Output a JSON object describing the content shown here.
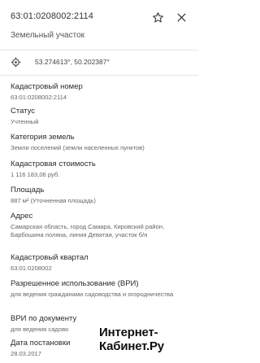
{
  "header": {
    "title": "63:01:0208002:2114",
    "subtitle": "Земельный участок"
  },
  "coords": {
    "text": "53.274613°, 50.202387°"
  },
  "fields": [
    {
      "label": "Кадастровый номер",
      "value": "63:01:0208002:2114"
    },
    {
      "label": "Статус",
      "value": "Учтенный"
    },
    {
      "label": "Категория земель",
      "value": "Земли поселений (земли населенных пунктов)"
    },
    {
      "label": "Кадастровая стоимость",
      "value": "1 116 183,06 руб."
    },
    {
      "label": "Площадь",
      "value": "887 м² (Уточненная площадь)"
    },
    {
      "label": "Адрес",
      "value": "Самарская область, город Самара, Кировский район, Барбошина поляна, линия Девятая, участок б/н"
    },
    {
      "label": "Кадастровый квартал",
      "value": "63:01:0208002"
    },
    {
      "label": "Разрешенное использование (ВРИ)",
      "value": "для ведения гражданами садоводства и огородничества"
    },
    {
      "label": "ВРИ по документу",
      "value": "для ведения садово"
    },
    {
      "label": "Дата постановки",
      "value": "28.03.2017"
    }
  ],
  "watermark": {
    "line1": "Интернет-",
    "line2": "Кабинет.Ру"
  },
  "icons": [
    "star-icon",
    "close-icon",
    "target-icon"
  ]
}
